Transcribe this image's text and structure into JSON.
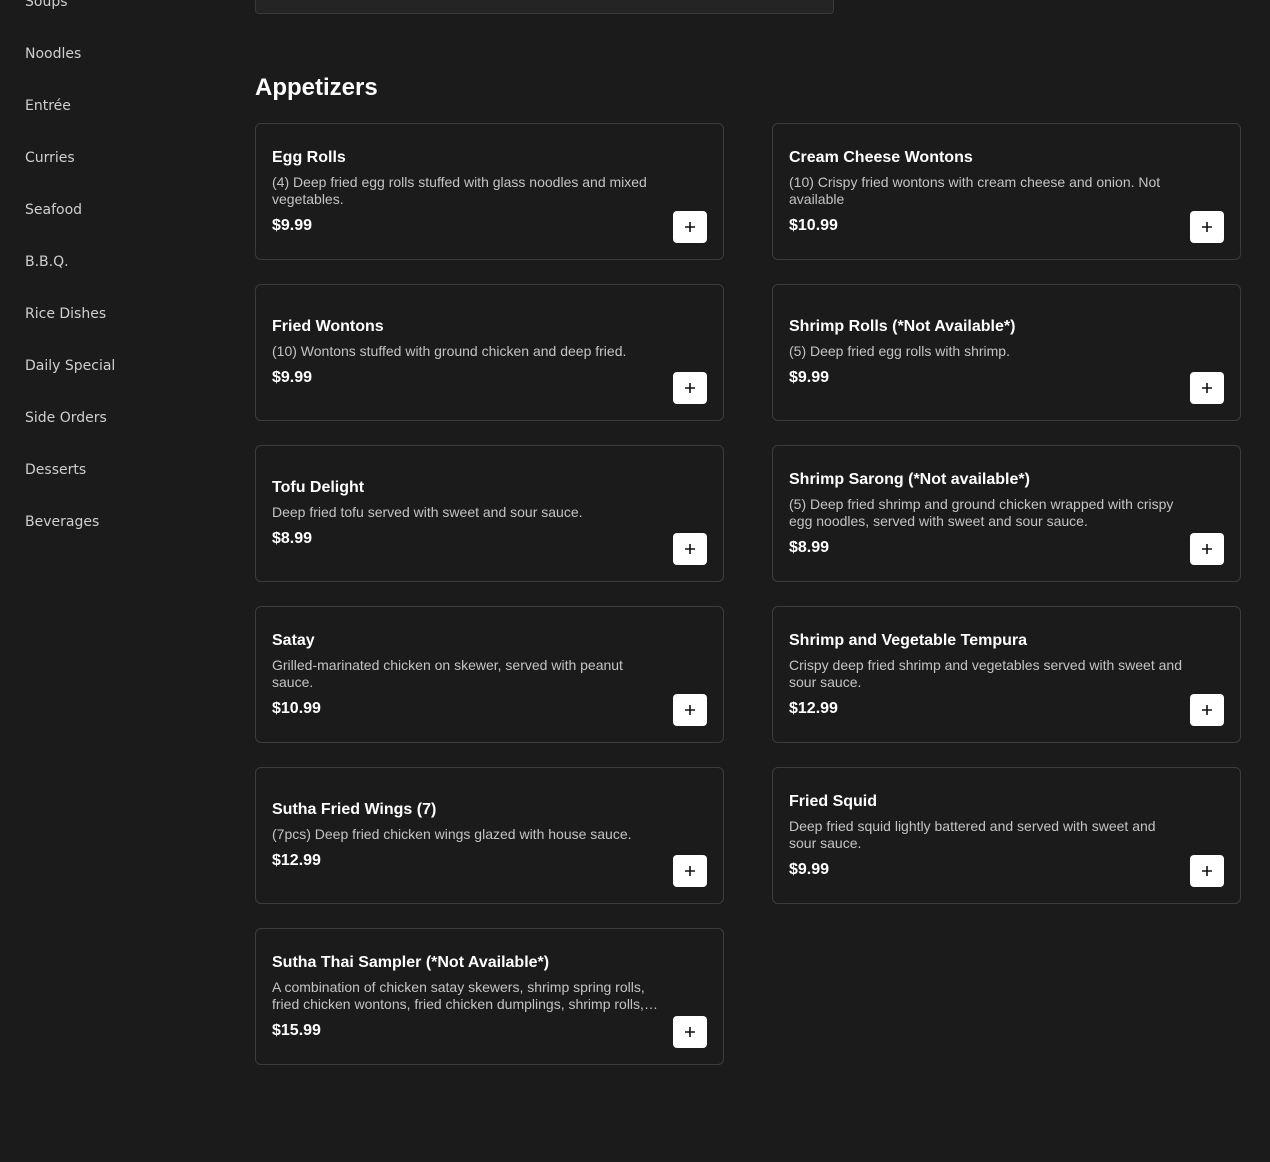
{
  "sidebar": {
    "items": [
      {
        "label": "Soups"
      },
      {
        "label": "Noodles"
      },
      {
        "label": "Entrée"
      },
      {
        "label": "Curries"
      },
      {
        "label": "Seafood"
      },
      {
        "label": "B.B.Q."
      },
      {
        "label": "Rice Dishes"
      },
      {
        "label": "Daily Special"
      },
      {
        "label": "Side Orders"
      },
      {
        "label": "Desserts"
      },
      {
        "label": "Beverages"
      }
    ]
  },
  "section": {
    "title": "Appetizers",
    "items": [
      {
        "name": "Egg Rolls",
        "desc": "(4) Deep fried egg rolls stuffed with glass noodles and mixed vegetables.",
        "price": "$9.99"
      },
      {
        "name": "Cream Cheese Wontons",
        "desc": "(10) Crispy fried wontons with cream cheese and onion. Not available",
        "price": "$10.99"
      },
      {
        "name": "Fried Wontons",
        "desc": "(10) Wontons stuffed with ground chicken and deep fried.",
        "price": "$9.99"
      },
      {
        "name": "Shrimp Rolls (*Not Available*)",
        "desc": "(5) Deep fried egg rolls with shrimp.",
        "price": "$9.99"
      },
      {
        "name": "Tofu Delight",
        "desc": "Deep fried tofu served with sweet and sour sauce.",
        "price": "$8.99"
      },
      {
        "name": "Shrimp Sarong (*Not available*)",
        "desc": "(5) Deep fried shrimp and ground chicken wrapped with crispy egg noodles, served with sweet and sour sauce.",
        "price": "$8.99"
      },
      {
        "name": "Satay",
        "desc": "Grilled-marinated chicken on skewer, served with peanut sauce.",
        "price": "$10.99"
      },
      {
        "name": "Shrimp and Vegetable Tempura",
        "desc": "Crispy deep fried shrimp and vegetables served with sweet and sour sauce.",
        "price": "$12.99"
      },
      {
        "name": "Sutha Fried Wings (7)",
        "desc": "(7pcs) Deep fried chicken wings glazed with house sauce.",
        "price": "$12.99"
      },
      {
        "name": "Fried Squid",
        "desc": "Deep fried squid lightly battered and served with sweet and sour sauce.",
        "price": "$9.99"
      },
      {
        "name": "Sutha Thai Sampler (*Not Available*)",
        "desc": "A combination of chicken satay skewers, shrimp spring rolls, fried chicken wontons, fried chicken dumplings, shrimp rolls, and cream cheese wontons.",
        "price": "$15.99"
      }
    ]
  }
}
